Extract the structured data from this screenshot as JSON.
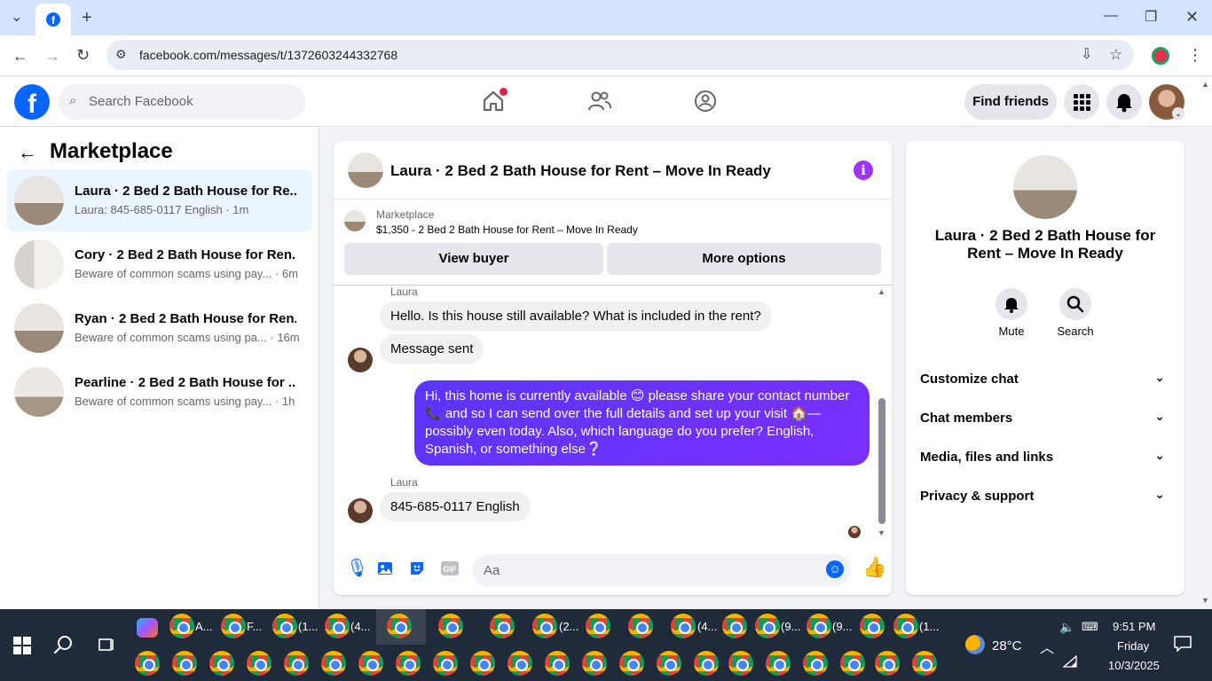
{
  "browser": {
    "url": "facebook.com/messages/t/1372603244332768",
    "new_tab_icon": "plus-icon"
  },
  "fb": {
    "search_placeholder": "Search Facebook",
    "find_friends": "Find friends"
  },
  "sidebar": {
    "title": "Marketplace",
    "conversations": [
      {
        "title": "Laura · 2 Bed 2 Bath House for Re...",
        "subtitle": "Laura: 845-685-0117 English · 1m",
        "active": true
      },
      {
        "title": "Cory · 2 Bed 2 Bath House for Ren...",
        "subtitle": "Beware of common scams using pay... · 6m",
        "active": false
      },
      {
        "title": "Ryan · 2 Bed 2 Bath House for Ren...",
        "subtitle": "Beware of common scams using pa... · 16m",
        "active": false
      },
      {
        "title": "Pearline · 2 Bed 2 Bath House for ...",
        "subtitle": "Beware of common scams using pay... · 1h",
        "active": false
      }
    ]
  },
  "chat": {
    "title": "Laura · 2 Bed 2 Bath House for Rent – Move In Ready",
    "marketplace_label": "Marketplace",
    "listing": "$1,350 - 2 Bed 2 Bath House for Rent – Move In Ready",
    "view_buyer": "View buyer",
    "more_options": "More options",
    "messages": {
      "sender1": "Laura",
      "msg1": "Hello.  Is this house still available?  What is included in the rent?",
      "msg2": "Message sent",
      "msg3": "Hi, this home is currently available 😊 please share your contact number 📞 and  so I can send over the full details and set up your visit 🏠—possibly even today. Also, which language do you prefer? English, Spanish, or something else❔",
      "sender2": "Laura",
      "msg4": "845-685-0117 English"
    },
    "composer_placeholder": "Aa"
  },
  "right_panel": {
    "title": "Laura · 2 Bed 2 Bath House for Rent – Move In Ready",
    "mute": "Mute",
    "search": "Search",
    "sections": [
      "Customize chat",
      "Chat members",
      "Media, files and links",
      "Privacy & support"
    ]
  },
  "taskbar": {
    "weather": "28°C",
    "time": "9:51 PM",
    "day": "Friday",
    "date": "10/3/2025",
    "app_labels": [
      "A...",
      "F...",
      "(1...",
      "(4...",
      "(2...",
      "(4...",
      "(9...",
      "(9...",
      "(1..."
    ]
  }
}
